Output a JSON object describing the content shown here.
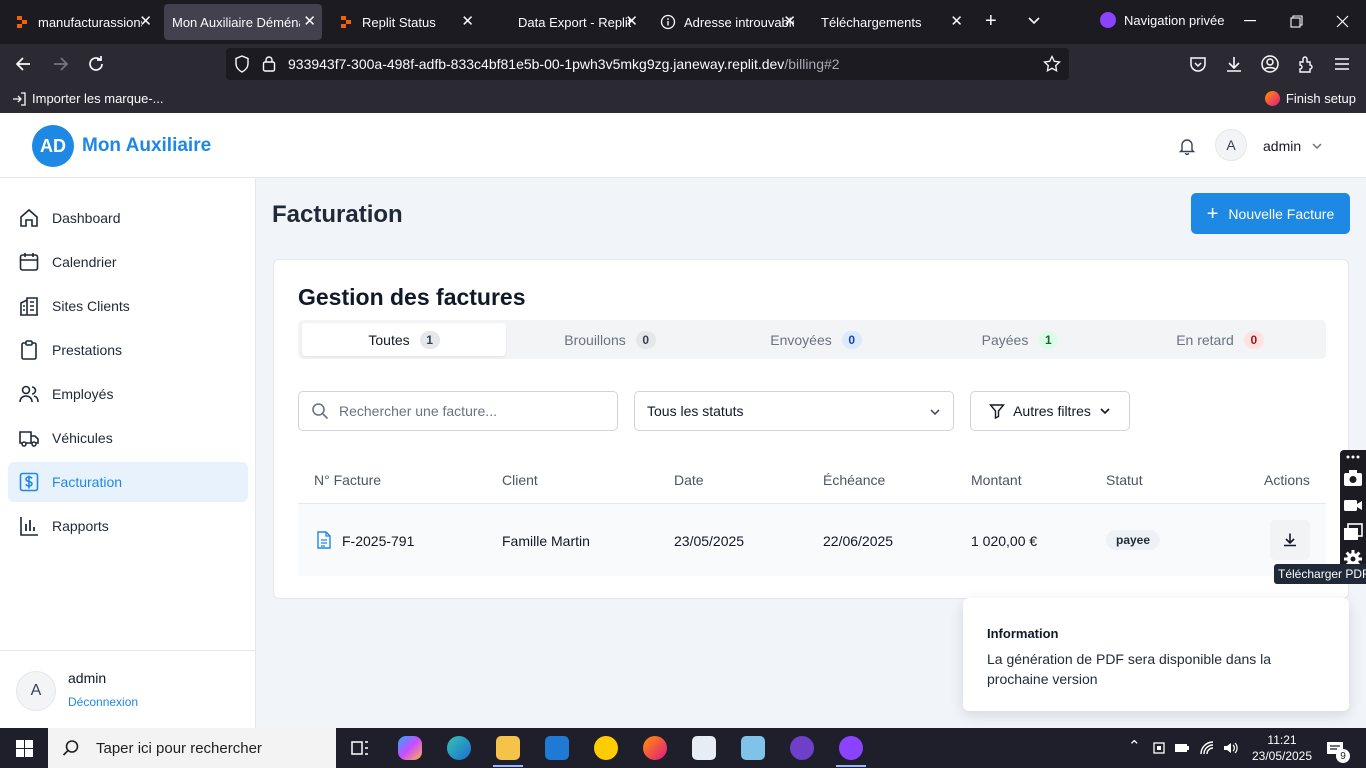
{
  "browser": {
    "tabs": [
      {
        "title": "manufacturassions",
        "active": false
      },
      {
        "title": "Mon Auxiliaire Déménag",
        "active": true
      },
      {
        "title": "Replit Status",
        "active": false
      },
      {
        "title": "Data Export - Replit",
        "active": false
      },
      {
        "title": "Adresse introuvable",
        "active": false
      },
      {
        "title": "Téléchargements",
        "active": false
      }
    ],
    "private_label": "Navigation privée",
    "url_host": "933943f7-300a-498f-adfb-833c4bf81e5b-00-1pwh3v5mkg9zg.janeway.replit.dev",
    "url_path": "/billing#2",
    "bookmark_import": "Importer les marque-...",
    "finish_setup": "Finish setup"
  },
  "app": {
    "logo_initials": "AD",
    "name": "Mon Auxiliaire",
    "user_initial": "A",
    "user_name": "admin"
  },
  "sidebar": {
    "items": [
      {
        "label": "Dashboard",
        "icon": "home-icon"
      },
      {
        "label": "Calendrier",
        "icon": "calendar-icon"
      },
      {
        "label": "Sites Clients",
        "icon": "building-icon"
      },
      {
        "label": "Prestations",
        "icon": "clipboard-icon"
      },
      {
        "label": "Employés",
        "icon": "users-icon"
      },
      {
        "label": "Véhicules",
        "icon": "truck-icon"
      },
      {
        "label": "Facturation",
        "icon": "dollar-icon",
        "active": true
      },
      {
        "label": "Rapports",
        "icon": "chart-icon"
      }
    ],
    "user_initial": "A",
    "user_name": "admin",
    "logout": "Déconnexion"
  },
  "page": {
    "title": "Facturation",
    "new_button": "Nouvelle Facture"
  },
  "card": {
    "title": "Gestion des factures",
    "tabs": [
      {
        "label": "Toutes",
        "count": "1",
        "badge": "gray"
      },
      {
        "label": "Brouillons",
        "count": "0",
        "badge": "gray"
      },
      {
        "label": "Envoyées",
        "count": "0",
        "badge": "blue"
      },
      {
        "label": "Payées",
        "count": "1",
        "badge": "green"
      },
      {
        "label": "En retard",
        "count": "0",
        "badge": "red"
      }
    ],
    "search_placeholder": "Rechercher une facture...",
    "status_select": "Tous les statuts",
    "filters_button": "Autres filtres",
    "columns": [
      "N° Facture",
      "Client",
      "Date",
      "Échéance",
      "Montant",
      "Statut",
      "Actions"
    ],
    "rows": [
      {
        "number": "F-2025-791",
        "client": "Famille Martin",
        "date": "23/05/2025",
        "due": "22/06/2025",
        "amount": "1 020,00 €",
        "status": "payee"
      }
    ],
    "download_tooltip": "Télécharger PDF"
  },
  "toast": {
    "title": "Information",
    "message": "La génération de PDF sera disponible dans la prochaine version"
  },
  "taskbar": {
    "search_placeholder": "Taper ici pour rechercher",
    "time": "11:21",
    "date": "23/05/2025",
    "notifications": "9"
  },
  "colors": {
    "primary": "#1e88e5",
    "browser_bg": "#1c1b22",
    "app_bg": "#f1f5f9"
  }
}
